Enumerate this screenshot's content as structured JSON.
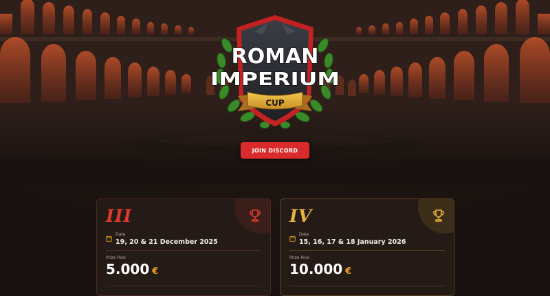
{
  "hero": {
    "logo": {
      "line1": "ROMAN",
      "line2": "IMPERIUM",
      "ribbon": "CUP"
    },
    "discord_button": "JOIN DISCORD"
  },
  "colors": {
    "accent_red": "#d92b2b",
    "gold": "#e8b341",
    "background": "#1a1210"
  },
  "tournaments": [
    {
      "numeral": "III",
      "date_label": "Date",
      "date": "19, 20 & 21 December 2025",
      "prize_label": "Prize Pool",
      "prize": "5.000",
      "currency": "€",
      "icon": "trophy-icon",
      "icon_color": "#e03a2e"
    },
    {
      "numeral": "IV",
      "date_label": "Date",
      "date": "15, 16, 17 & 18 January 2026",
      "prize_label": "Prize Pool",
      "prize": "10.000",
      "currency": "€",
      "icon": "trophy-icon",
      "icon_color": "#e8b341"
    }
  ]
}
